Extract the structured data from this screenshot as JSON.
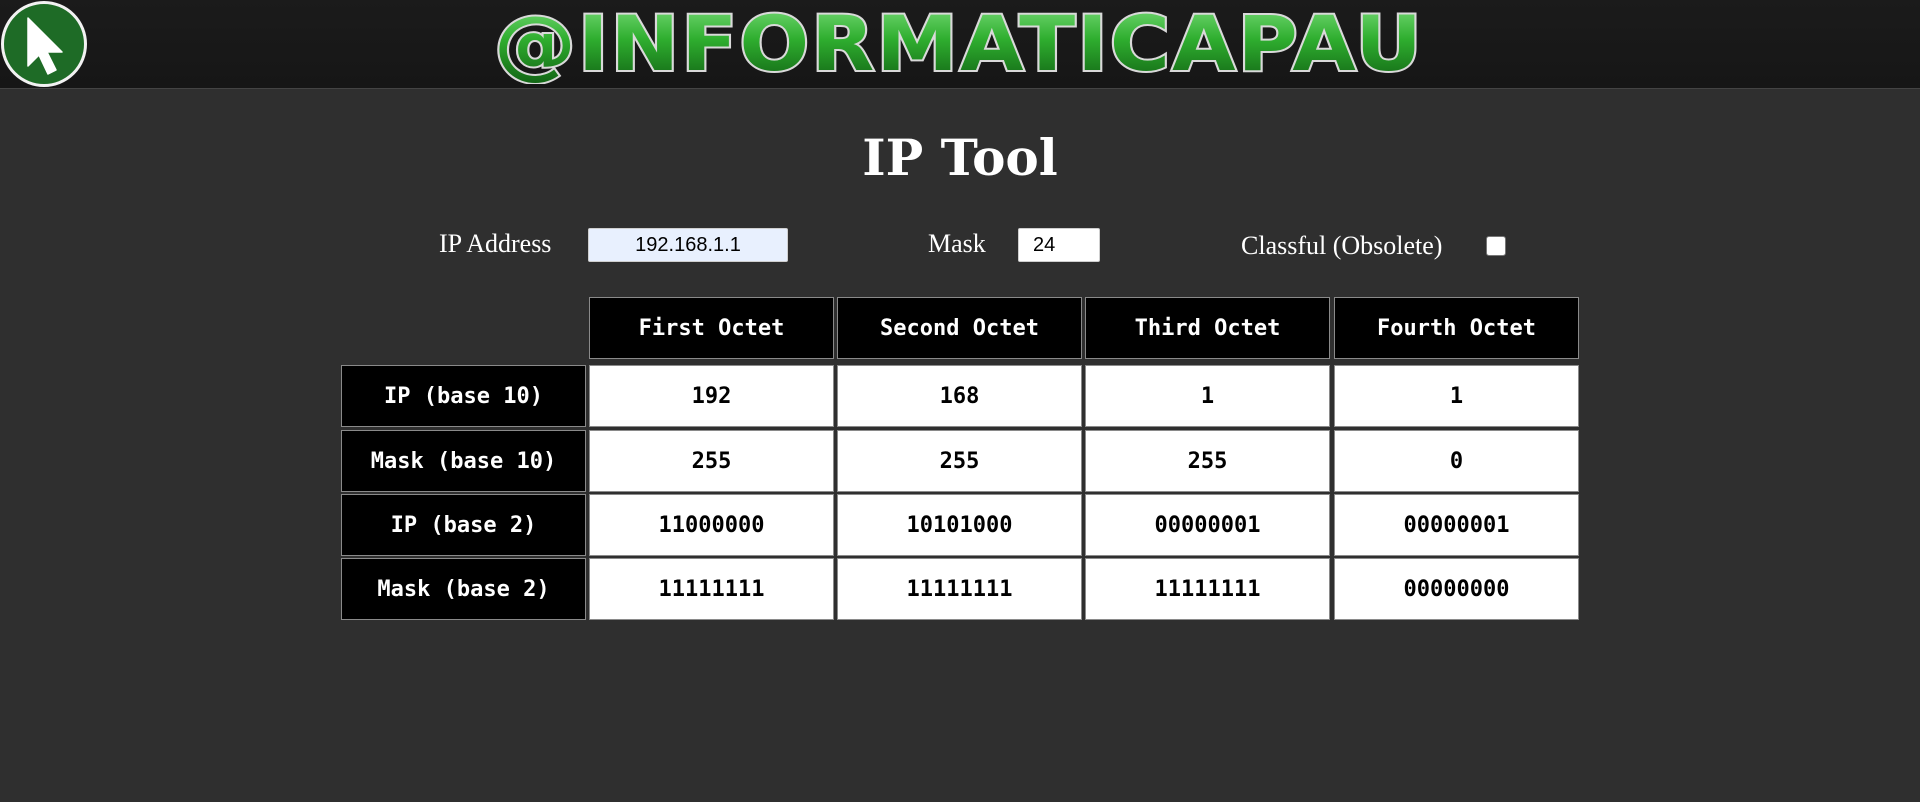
{
  "header": {
    "logo_text": "@INFORMATICAPAU",
    "colors": {
      "bar": "#1b1b1b",
      "logo_green": "#2fae2f",
      "home_button": "#1e6b26"
    }
  },
  "title": "IP Tool",
  "form": {
    "ip_label": "IP Address",
    "ip_value": "192.168.1.1",
    "mask_label": "Mask",
    "mask_value": "24",
    "classful_label": "Classful (Obsolete)",
    "classful_checked": false
  },
  "table": {
    "columns": [
      "First Octet",
      "Second Octet",
      "Third Octet",
      "Fourth Octet"
    ],
    "rows": [
      {
        "label": "IP (base 10)",
        "cells": [
          "192",
          "168",
          "1",
          "1"
        ]
      },
      {
        "label": "Mask (base 10)",
        "cells": [
          "255",
          "255",
          "255",
          "0"
        ]
      },
      {
        "label": "IP (base 2)",
        "cells": [
          "11000000",
          "10101000",
          "00000001",
          "00000001"
        ]
      },
      {
        "label": "Mask (base 2)",
        "cells": [
          "11111111",
          "11111111",
          "11111111",
          "00000000"
        ]
      }
    ]
  }
}
